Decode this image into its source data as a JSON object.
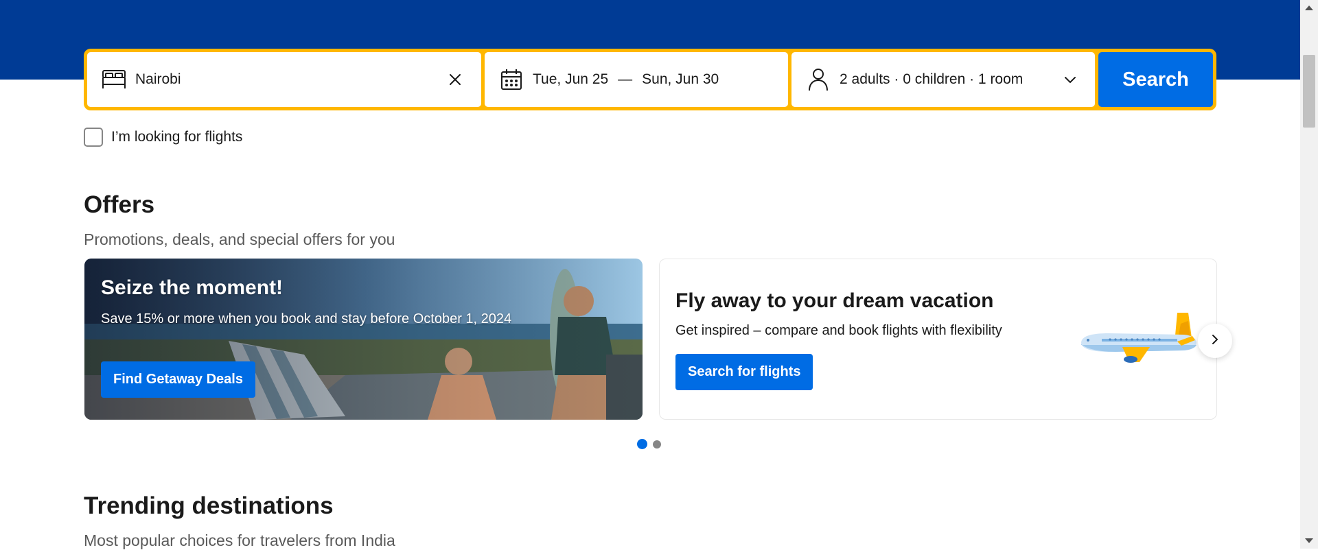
{
  "search": {
    "destination_value": "Nairobi",
    "checkin": "Tue, Jun 25",
    "date_separator": "—",
    "checkout": "Sun, Jun 30",
    "occupancy": "2 adults · 0 children · 1 room",
    "search_label": "Search"
  },
  "flights_checkbox": {
    "label": "I’m looking for flights",
    "checked": false
  },
  "offers": {
    "title": "Offers",
    "subtitle": "Promotions, deals, and special offers for you",
    "cards": [
      {
        "title": "Seize the moment!",
        "description": "Save 15% or more when you book and stay before October 1, 2024",
        "button": "Find Getaway Deals"
      },
      {
        "title": "Fly away to your dream vacation",
        "description": "Get inspired – compare and book flights with flexibility",
        "button": "Search for flights"
      }
    ],
    "carousel": {
      "active_page": 1,
      "total_pages": 2
    }
  },
  "trending": {
    "title": "Trending destinations",
    "subtitle": "Most popular choices for travelers from India"
  },
  "colors": {
    "brand_blue": "#003b95",
    "search_border": "#ffb700",
    "button_blue": "#006ce4"
  },
  "icons": [
    "bed-icon",
    "close-icon",
    "calendar-icon",
    "person-icon",
    "chevron-down-icon",
    "chevron-right-icon",
    "airplane-illustration"
  ]
}
